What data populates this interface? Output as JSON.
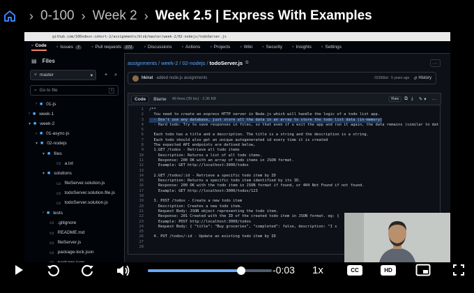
{
  "breadcrumb": {
    "items": [
      "0-100",
      "Week 2"
    ],
    "current": "Week 2.5 | Express With Examples"
  },
  "browser": {
    "url": "github.com/100xdevs-cohort-2/assignments/blob/master/week-2/02-nodejs/todoServer.js"
  },
  "repo_nav": {
    "tabs": [
      {
        "label": "Code",
        "icon": "code-icon",
        "count": ""
      },
      {
        "label": "Issues",
        "icon": "issue-icon",
        "count": "7"
      },
      {
        "label": "Pull requests",
        "icon": "pr-icon",
        "count": "272"
      },
      {
        "label": "Discussions",
        "icon": "discussion-icon",
        "count": ""
      },
      {
        "label": "Actions",
        "icon": "play-icon",
        "count": ""
      },
      {
        "label": "Projects",
        "icon": "table-icon",
        "count": ""
      },
      {
        "label": "Wiki",
        "icon": "book-icon",
        "count": ""
      },
      {
        "label": "Security",
        "icon": "shield-icon",
        "count": ""
      },
      {
        "label": "Insights",
        "icon": "graph-icon",
        "count": ""
      },
      {
        "label": "Settings",
        "icon": "gear-icon",
        "count": ""
      }
    ]
  },
  "sidebar": {
    "title": "Files",
    "branch": "master",
    "search_placeholder": "Go to file",
    "search_shortcut": "t",
    "tree": [
      {
        "label": "01-js",
        "type": "folder",
        "indent": 1
      },
      {
        "label": "week-1",
        "type": "folder",
        "indent": 0
      },
      {
        "label": "week-2",
        "type": "folder-open",
        "indent": 0
      },
      {
        "label": "01-async-js",
        "type": "folder",
        "indent": 1
      },
      {
        "label": "02-nodejs",
        "type": "folder-open",
        "indent": 1
      },
      {
        "label": "files",
        "type": "folder-open",
        "indent": 2
      },
      {
        "label": "a.txt",
        "type": "file",
        "indent": 3
      },
      {
        "label": "solutions",
        "type": "folder-open",
        "indent": 2
      },
      {
        "label": "fileServer.solution.js",
        "type": "file",
        "indent": 3
      },
      {
        "label": "todoServer.solution.file.js",
        "type": "file",
        "indent": 3
      },
      {
        "label": "todoServer.solution.js",
        "type": "file",
        "indent": 3
      },
      {
        "label": "tests",
        "type": "folder",
        "indent": 2
      },
      {
        "label": ".gitignore",
        "type": "file",
        "indent": 2
      },
      {
        "label": "README.md",
        "type": "file",
        "indent": 2
      },
      {
        "label": "fileServer.js",
        "type": "file",
        "indent": 2
      },
      {
        "label": "package-lock.json",
        "type": "file",
        "indent": 2
      },
      {
        "label": "package.json",
        "type": "file",
        "indent": 2
      },
      {
        "label": "todoServer.js",
        "type": "file",
        "indent": 2
      }
    ]
  },
  "file": {
    "path": [
      "assignments",
      "week-2",
      "02-nodejs"
    ],
    "name": "todoServer.js",
    "commit_author": "hkirat",
    "commit_message": "added node.js assignments",
    "commit_hash": "02356bd · 5 years ago",
    "history_label": "History",
    "code_tab": "Code",
    "blame_tab": "Blame",
    "meta": "49 lines (39 loc) · 2.36 KB"
  },
  "code_lines": [
    {
      "n": "1",
      "t": "/**",
      "hl": false
    },
    {
      "n": "2",
      "t": "  You need to create an express HTTP server in Node.js which will handle the logic of a todo list app.",
      "hl": false
    },
    {
      "n": "3",
      "t": "  - Don't use any database, just store all the data in an array to store the todo list data (in-memory)",
      "hl": true
    },
    {
      "n": "4",
      "t": "  - Hard todo: Try to save responses in files, so that even if u exit the app and run it again, the data remains (similar to dat",
      "hl": false
    },
    {
      "n": "5",
      "t": "",
      "hl": false
    },
    {
      "n": "6",
      "t": "  Each todo has a title and a description. The title is a string and the description is a string.",
      "hl": false
    },
    {
      "n": "7",
      "t": "  Each todo should also get an unique autogenerated id every time it is created",
      "hl": false
    },
    {
      "n": "8",
      "t": "  The expected API endpoints are defined below,",
      "hl": false
    },
    {
      "n": "9",
      "t": "  1.GET /todos - Retrieve all todo items",
      "hl": false
    },
    {
      "n": "10",
      "t": "    Description: Returns a list of all todo items.",
      "hl": false
    },
    {
      "n": "11",
      "t": "    Response: 200 OK with an array of todo items in JSON format.",
      "hl": false
    },
    {
      "n": "12",
      "t": "    Example: GET http://localhost:3000/todos",
      "hl": false
    },
    {
      "n": "13",
      "t": "",
      "hl": false
    },
    {
      "n": "14",
      "t": "  2.GET /todos/:id - Retrieve a specific todo item by ID",
      "hl": false
    },
    {
      "n": "15",
      "t": "    Description: Returns a specific todo item identified by its ID.",
      "hl": false
    },
    {
      "n": "16",
      "t": "    Response: 200 OK with the todo item in JSON format if found, or 404 Not Found if not found.",
      "hl": false
    },
    {
      "n": "17",
      "t": "    Example: GET http://localhost:3000/todos/123",
      "hl": false
    },
    {
      "n": "18",
      "t": "",
      "hl": false
    },
    {
      "n": "19",
      "t": "  3. POST /todos - Create a new todo item",
      "hl": false
    },
    {
      "n": "20",
      "t": "    Description: Creates a new todo item.",
      "hl": false
    },
    {
      "n": "21",
      "t": "    Request Body: JSON object representing the todo item.",
      "hl": false
    },
    {
      "n": "22",
      "t": "    Response: 201 Created with the ID of the created todo item in JSON format. eg: {",
      "hl": false
    },
    {
      "n": "23",
      "t": "    Example: POST http://localhost:3000/todos",
      "hl": false
    },
    {
      "n": "24",
      "t": "    Request Body: { \"title\": \"Buy groceries\", \"completed\": false, description: \"I s",
      "hl": false
    },
    {
      "n": "25",
      "t": "",
      "hl": false
    },
    {
      "n": "26",
      "t": "  4. PUT /todos/:id - Update an existing todo item by ID",
      "hl": false
    },
    {
      "n": "27",
      "t": "",
      "hl": false
    },
    {
      "n": "28",
      "t": "",
      "hl": false
    }
  ],
  "player": {
    "progress": 0.75,
    "time_left": "-0:03",
    "speed": "1x",
    "cc_label": "CC",
    "hd_label": "HD"
  },
  "colors": {
    "accent": "#6aa6ff",
    "link": "#58a6ff",
    "github_bg": "#0d1117"
  }
}
